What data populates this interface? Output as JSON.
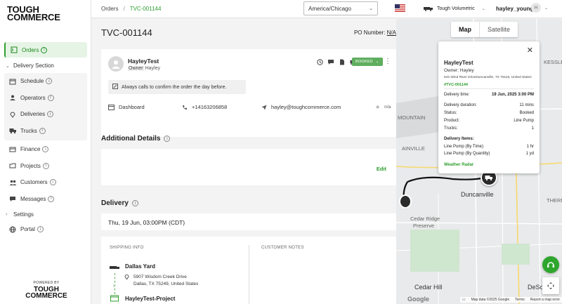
{
  "brand": {
    "logo_line1": "TOUGH",
    "logo_line2": "COMMERCE",
    "powered_by": "POWERED BY",
    "accent": "#2e9e2e"
  },
  "sidebar": {
    "orders": "Orders",
    "delivery_section": "Delivery Section",
    "delivery_items": [
      "Schedule",
      "Operators",
      "Deliveries",
      "Trucks"
    ],
    "finance": "Finance",
    "projects": "Projects",
    "customers": "Customers",
    "messages": "Messages",
    "settings": "Settings",
    "portal": "Portal"
  },
  "topbar": {
    "breadcrumb_root": "Orders",
    "breadcrumb_current": "TVC-001144",
    "timezone": "America/Chicago",
    "company": "Tough Volumetric",
    "username": "hayley_young",
    "avatar_initial": "H"
  },
  "order": {
    "id": "TVC-001144",
    "po_label": "PO Number:",
    "po_value": "N/A",
    "contact_name": "HayleyTest",
    "owner_label": "Owner",
    "owner_name": "Hayley",
    "status": "BOOKED",
    "note": "Always calls to confirm the order the day before.",
    "source": "Dashboard",
    "phone": "+14163206858",
    "email": "hayley@toughcommerce.com",
    "rating": "n/a"
  },
  "additional_details": {
    "title": "Additional Details",
    "edit_label": "Edit"
  },
  "delivery": {
    "title": "Delivery",
    "date": "Thu, 19 Jun, 03:00PM (CDT)",
    "shipping_info_label": "SHIPPING INFO",
    "customer_notes_label": "CUSTOMER NOTES",
    "origin_name": "Dallas Yard",
    "origin_addr1": "5907 Wisdom Creek Drive",
    "origin_addr2": "Dallas, TX 75249, United States",
    "destination_name": "HayleyTest-Project"
  },
  "map": {
    "tab_map": "Map",
    "tab_satellite": "Satellite",
    "places": {
      "mountain": "MOUNTAIN",
      "ainville": "AINVILLE",
      "duncanville": "Duncanville",
      "cedar_ridge": "Cedar Ridge",
      "preserve": "Preserve",
      "cedar_hill": "Cedar Hill",
      "desoto": "DeSoto",
      "kessle": "KESSLE",
      "thern": "THERN"
    },
    "attribution": {
      "google": "Google",
      "data": "Map data ©2025 Google",
      "terms": "Terms",
      "report": "Report a map error"
    },
    "popup": {
      "name": "HayleyTest",
      "owner": "Owner: Hayley",
      "address": "542 Wind River DriveDuncanville, TX 75116, United States",
      "order_id": "#TVC-001144",
      "rows": [
        {
          "label": "Delivery time:",
          "value": "19 Jun, 2025 3:00 PM"
        },
        {
          "label": "Delivery duration:",
          "value": "11 mins"
        },
        {
          "label": "Status:",
          "value": "Booked"
        },
        {
          "label": "Product:",
          "value": "Line Pump"
        },
        {
          "label": "Trucks:",
          "value": "1"
        }
      ],
      "items_title": "Delivery Items:",
      "items": [
        {
          "label": "Line Pump (By Time)",
          "value": "1 hr"
        },
        {
          "label": "Line Pump (By Quantity)",
          "value": "1 yd"
        }
      ],
      "weather_link": "Weather Radar"
    }
  }
}
